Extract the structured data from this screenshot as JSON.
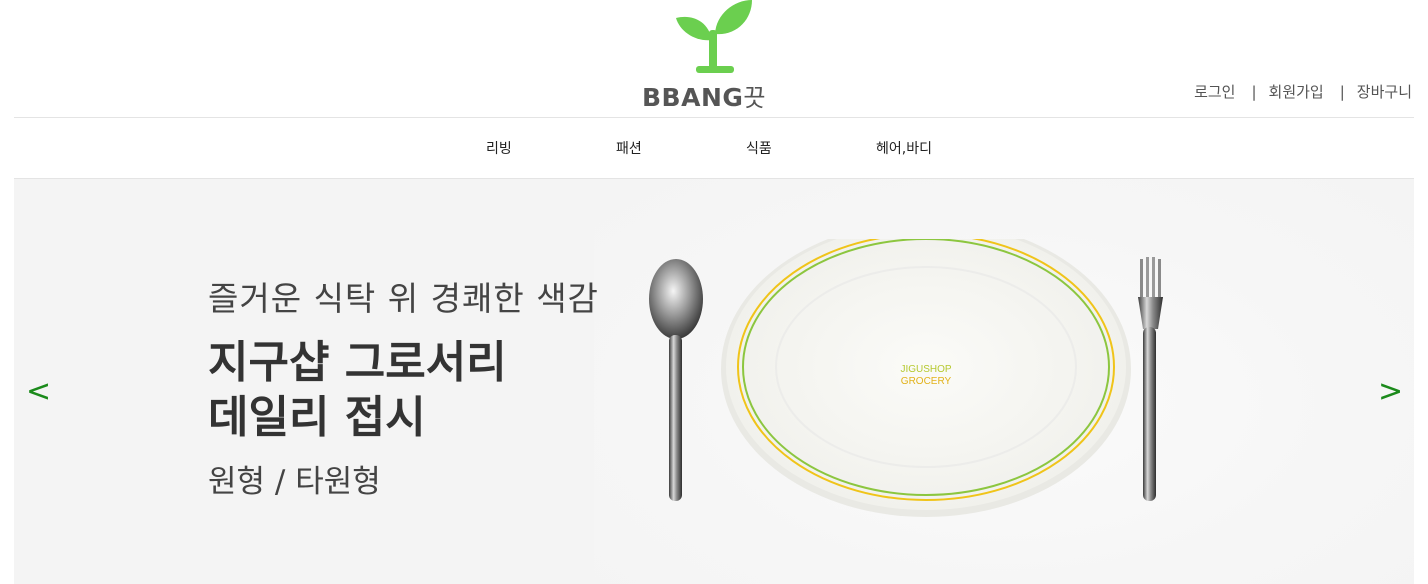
{
  "logo": {
    "brand": "BBANG",
    "suffix": "끗"
  },
  "header": {
    "util": [
      {
        "label": "로그인"
      },
      {
        "label": "회원가입"
      },
      {
        "label": "장바구니"
      }
    ],
    "separator": "|"
  },
  "nav": {
    "items": [
      {
        "label": "리빙"
      },
      {
        "label": "패션"
      },
      {
        "label": "식품"
      },
      {
        "label": "헤어,바디"
      }
    ]
  },
  "banner": {
    "subhead": "즐거운 식탁 위 경쾌한 색감",
    "headline_line1": "지구샵 그로서리",
    "headline_line2": "데일리 접시",
    "caption": "원형 / 타원형",
    "prev_label": "<",
    "next_label": ">",
    "plate_text_line1": "JIGUSHOP",
    "plate_text_line2": "GROCERY"
  },
  "colors": {
    "logo_green": "#6bcf4f",
    "arrow_green": "#1b8a1b",
    "plate_yellow": "#f0c419",
    "plate_green": "#8cc63f"
  }
}
